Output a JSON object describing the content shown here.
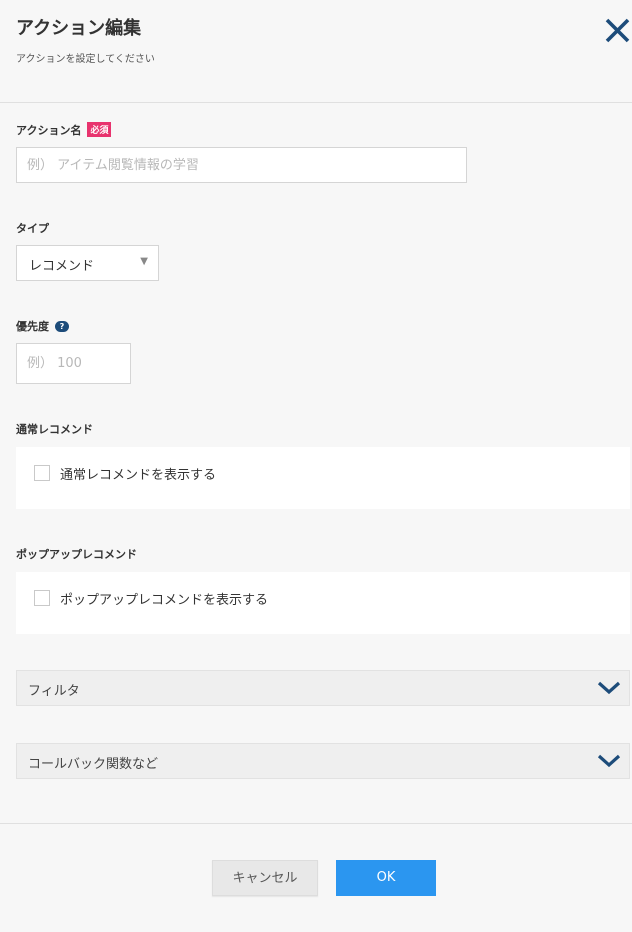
{
  "header": {
    "title": "アクション編集",
    "subtitle": "アクションを設定してください"
  },
  "action_name": {
    "label": "アクション名",
    "required_badge": "必須",
    "placeholder": "例） アイテム閲覧情報の学習",
    "value": ""
  },
  "type": {
    "label": "タイプ",
    "selected": "レコメンド"
  },
  "priority": {
    "label": "優先度",
    "help_glyph": "?",
    "placeholder": "例） 100",
    "value": ""
  },
  "normal_recommend": {
    "label": "通常レコメンド",
    "checkbox_label": "通常レコメンドを表示する",
    "checked": false
  },
  "popup_recommend": {
    "label": "ポップアップレコメンド",
    "checkbox_label": "ポップアップレコメンドを表示する",
    "checked": false
  },
  "accordions": {
    "filter": "フィルタ",
    "callback": "コールバック関数など"
  },
  "footer": {
    "cancel": "キャンセル",
    "ok": "OK"
  },
  "colors": {
    "accent_blue": "#2b96f0",
    "navy": "#1d4c7a",
    "required_pink": "#e8336e"
  },
  "icons": {
    "close": "close-icon",
    "chevron": "chevron-down-icon",
    "select_arrow": "triangle-down-icon",
    "help": "help-icon"
  }
}
